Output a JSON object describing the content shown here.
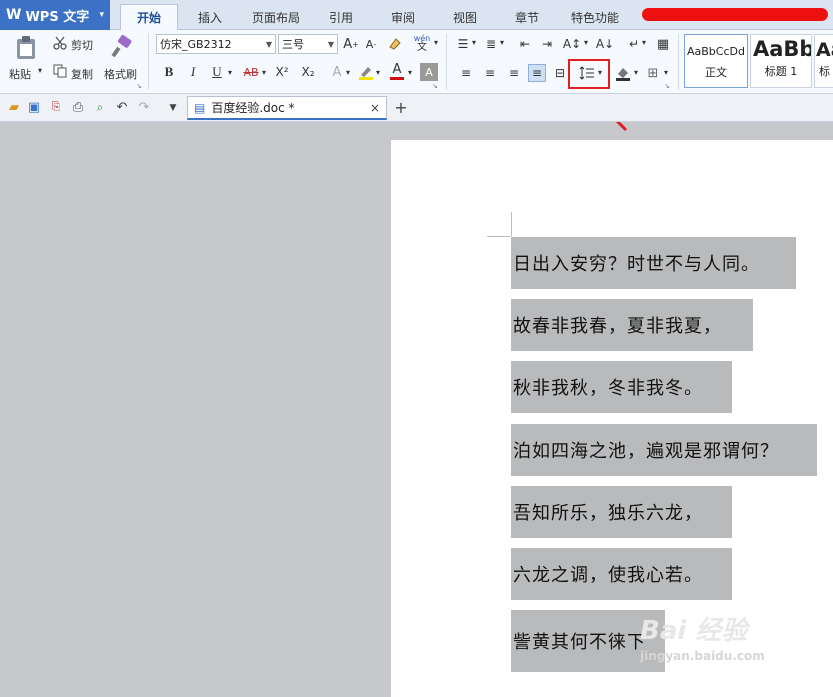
{
  "app": {
    "title": "WPS 文字",
    "menu_arrow": "▾"
  },
  "tabs": [
    {
      "label": "开始",
      "active": true
    },
    {
      "label": "插入"
    },
    {
      "label": "页面布局"
    },
    {
      "label": "引用"
    },
    {
      "label": "审阅"
    },
    {
      "label": "视图"
    },
    {
      "label": "章节"
    },
    {
      "label": "特色功能"
    }
  ],
  "clipboard": {
    "paste": "粘贴",
    "cut": "剪切",
    "copy": "复制",
    "format_painter": "格式刷"
  },
  "font": {
    "family": "仿宋_GB2312",
    "size": "三号",
    "bold": "B",
    "italic": "I",
    "underline": "U",
    "strike": "AB",
    "superscript": "X²",
    "subscript": "X₂",
    "color_letter": "A",
    "wen": "wén"
  },
  "styles": {
    "sample1": "AaBbCcDd",
    "name1": "正文",
    "sample2": "AaBb",
    "name2": "标题 1",
    "sample3": "Aa",
    "name3": "标"
  },
  "quick_toolbar": {
    "doc_name": "百度经验.doc *",
    "close": "×",
    "new_tab": "+"
  },
  "document": {
    "lines": [
      "日出入安穷？时世不与人同。",
      "故春非我春，夏非我夏，",
      "秋非我秋，冬非我冬。",
      "泊如四海之池，遍观是邪谓何？",
      "吾知所乐，独乐六龙，",
      "六龙之调，使我心若。",
      "訾黄其何不徕下"
    ]
  },
  "watermark": {
    "big": "Bai 经验",
    "small": "jingyan.baidu.com"
  },
  "colors": {
    "accent": "#3b72c5",
    "highlight_box": "#e02020",
    "selection": "#b9babc"
  }
}
